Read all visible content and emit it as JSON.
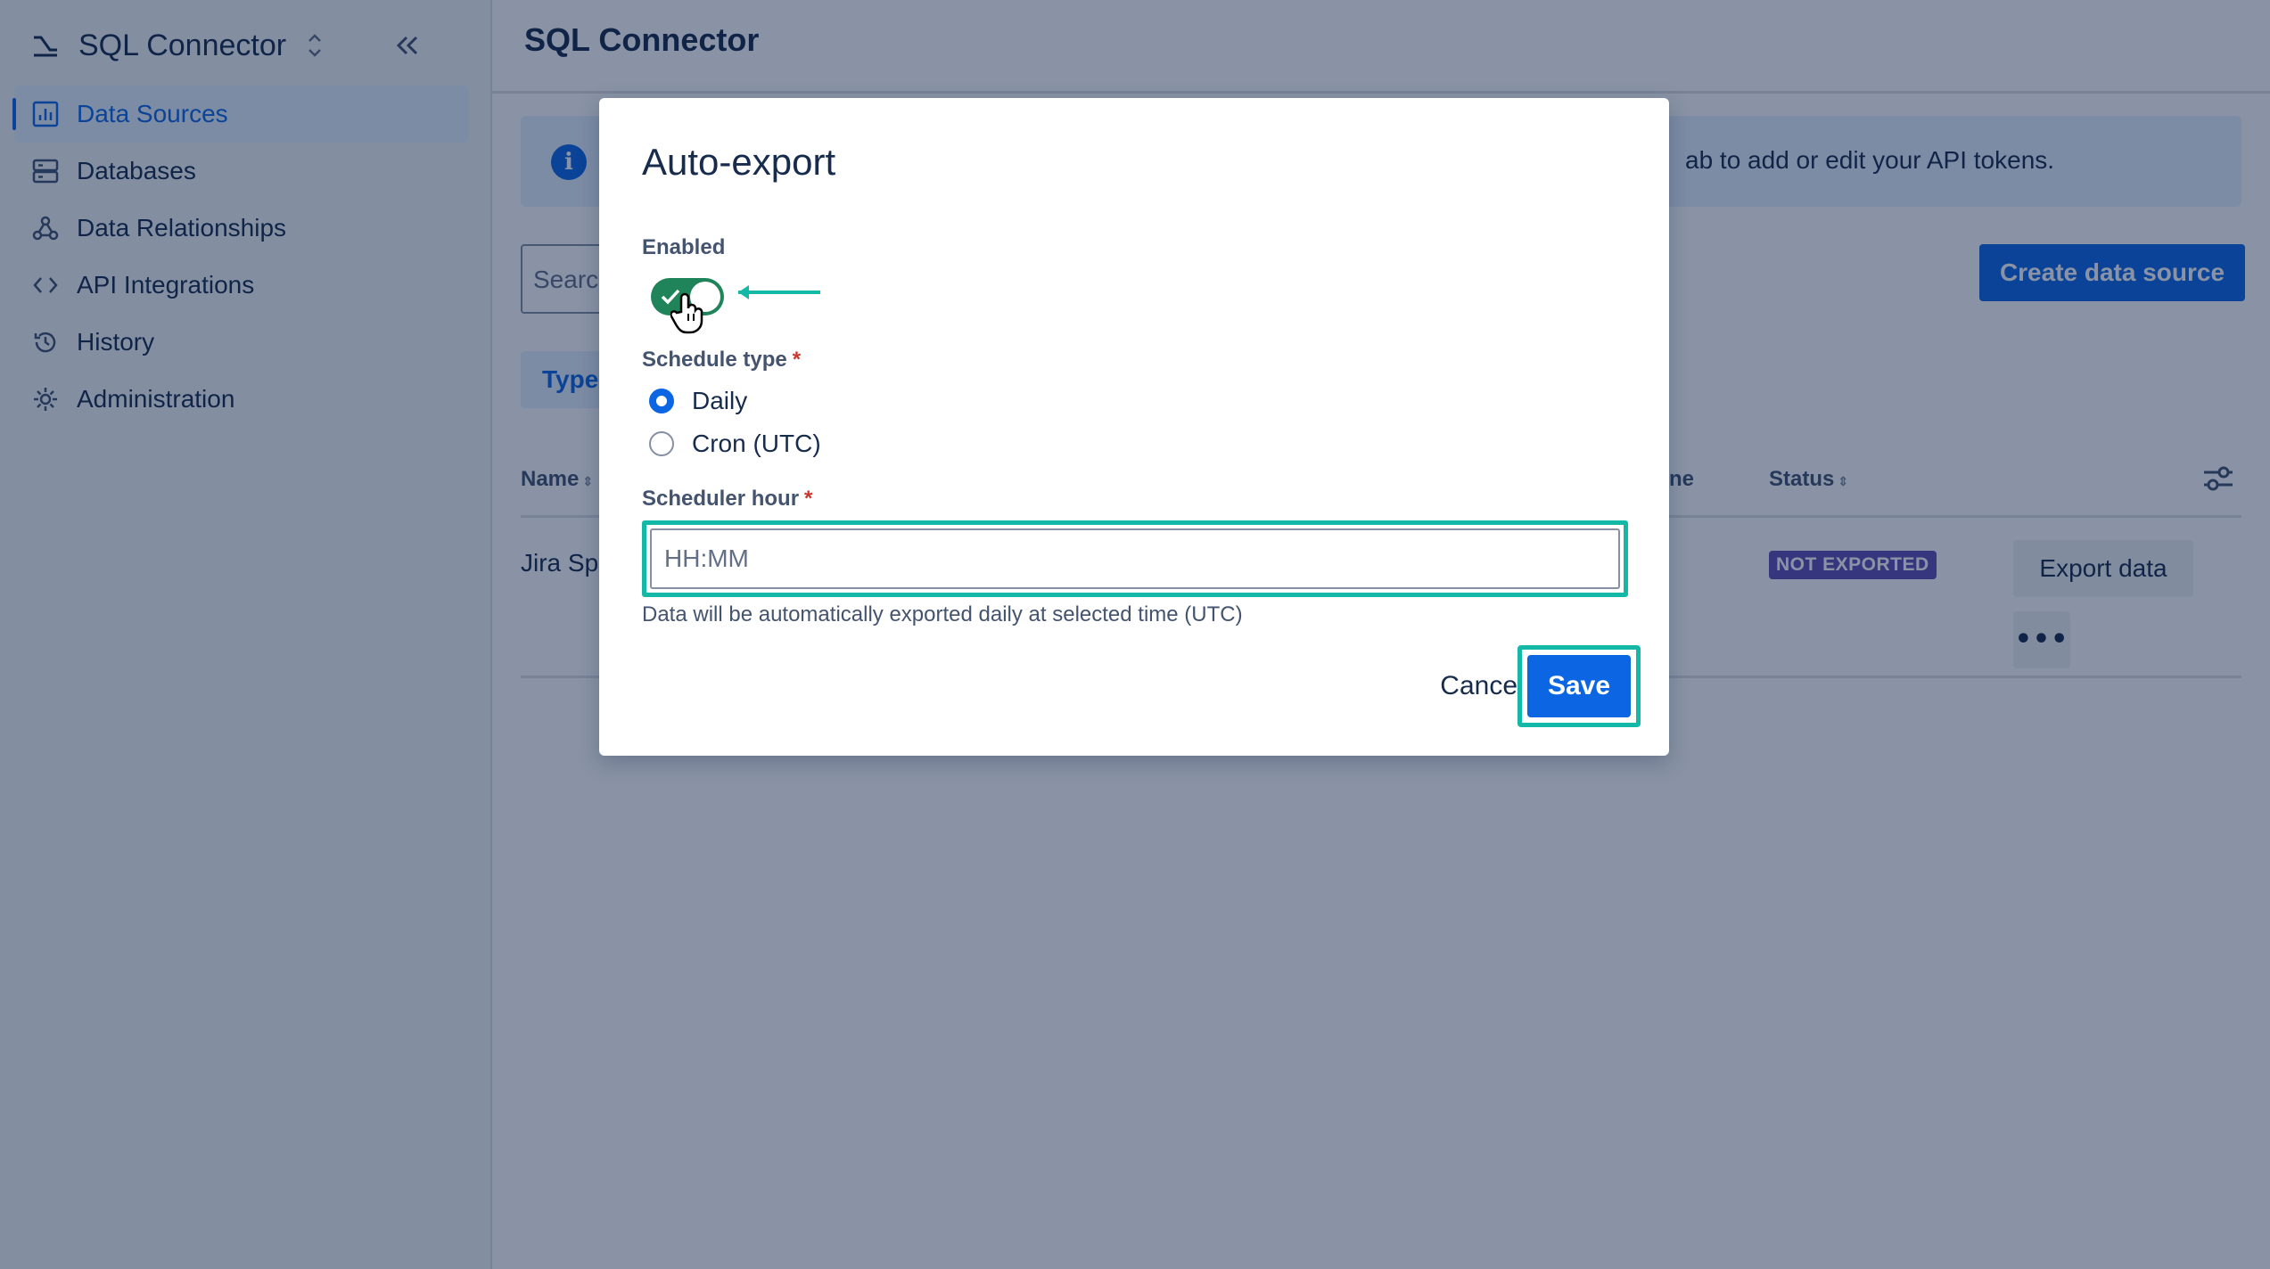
{
  "sidebar": {
    "title": "SQL Connector",
    "items": [
      {
        "label": "Data Sources",
        "icon": "chart-icon",
        "active": true
      },
      {
        "label": "Databases",
        "icon": "database-icon"
      },
      {
        "label": "Data Relationships",
        "icon": "webhook-icon"
      },
      {
        "label": "API Integrations",
        "icon": "code-icon"
      },
      {
        "label": "History",
        "icon": "history-icon"
      },
      {
        "label": "Administration",
        "icon": "gear-icon"
      }
    ]
  },
  "main": {
    "title": "SQL Connector",
    "banner_text": "ab to add or edit your API tokens.",
    "search_placeholder": "Searc",
    "create_button": "Create data source",
    "type_filter": "Type",
    "columns": {
      "name": "Name",
      "partial": "ne",
      "status": "Status"
    },
    "row": {
      "name": "Jira Sp",
      "status": "NOT EXPORTED",
      "export_button": "Export data",
      "more_button": "•••"
    }
  },
  "modal": {
    "title": "Auto-export",
    "enabled_label": "Enabled",
    "enabled": true,
    "schedule_type_label": "Schedule type",
    "required_mark": "*",
    "options": [
      {
        "label": "Daily",
        "checked": true
      },
      {
        "label": "Cron (UTC)",
        "checked": false
      }
    ],
    "scheduler_hour_label": "Scheduler hour",
    "scheduler_hour_placeholder": "HH:MM",
    "help_text": "Data will be automatically exported daily at selected time (UTC)",
    "cancel_button": "Cancel",
    "save_button": "Save"
  },
  "colors": {
    "accent": "#0c66e4",
    "toggle_on": "#1f845a",
    "highlight": "#14b8a6",
    "badge": "#5e4db2"
  }
}
